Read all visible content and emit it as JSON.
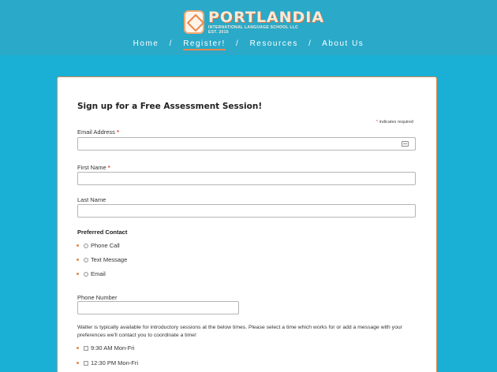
{
  "header": {
    "logo_title": "PORTLANDIA",
    "logo_subtitle": "INTERNATIONAL LANGUAGE SCHOOL LLC",
    "logo_est": "EST. 2016",
    "nav": [
      {
        "label": "Home"
      },
      {
        "label": "Register!"
      },
      {
        "label": "Resources"
      },
      {
        "label": "About Us"
      }
    ],
    "nav_separator": "/"
  },
  "form": {
    "title": "Sign up for a Free Assessment Session!",
    "required_note_star": "*",
    "required_note": "indicates required",
    "fields": {
      "email": {
        "label": "Email Address",
        "required_mark": "*",
        "value": ""
      },
      "first_name": {
        "label": "First Name",
        "required_mark": "*",
        "value": ""
      },
      "last_name": {
        "label": "Last Name",
        "value": ""
      },
      "phone": {
        "label": "Phone Number",
        "value": ""
      }
    },
    "preferred_contact": {
      "label": "Preferred Contact",
      "options": [
        {
          "label": "Phone Call"
        },
        {
          "label": "Text Message"
        },
        {
          "label": "Email"
        }
      ]
    },
    "availability_text": "Walter is typically available for introductory sessions at the below times. Please select a time which works for or add a message with your preferences we'll contact you to coordinate a time!",
    "time_options": [
      {
        "label": "9:30 AM Mon-Fri"
      },
      {
        "label": "12:30 PM Mon-Fri"
      }
    ]
  }
}
